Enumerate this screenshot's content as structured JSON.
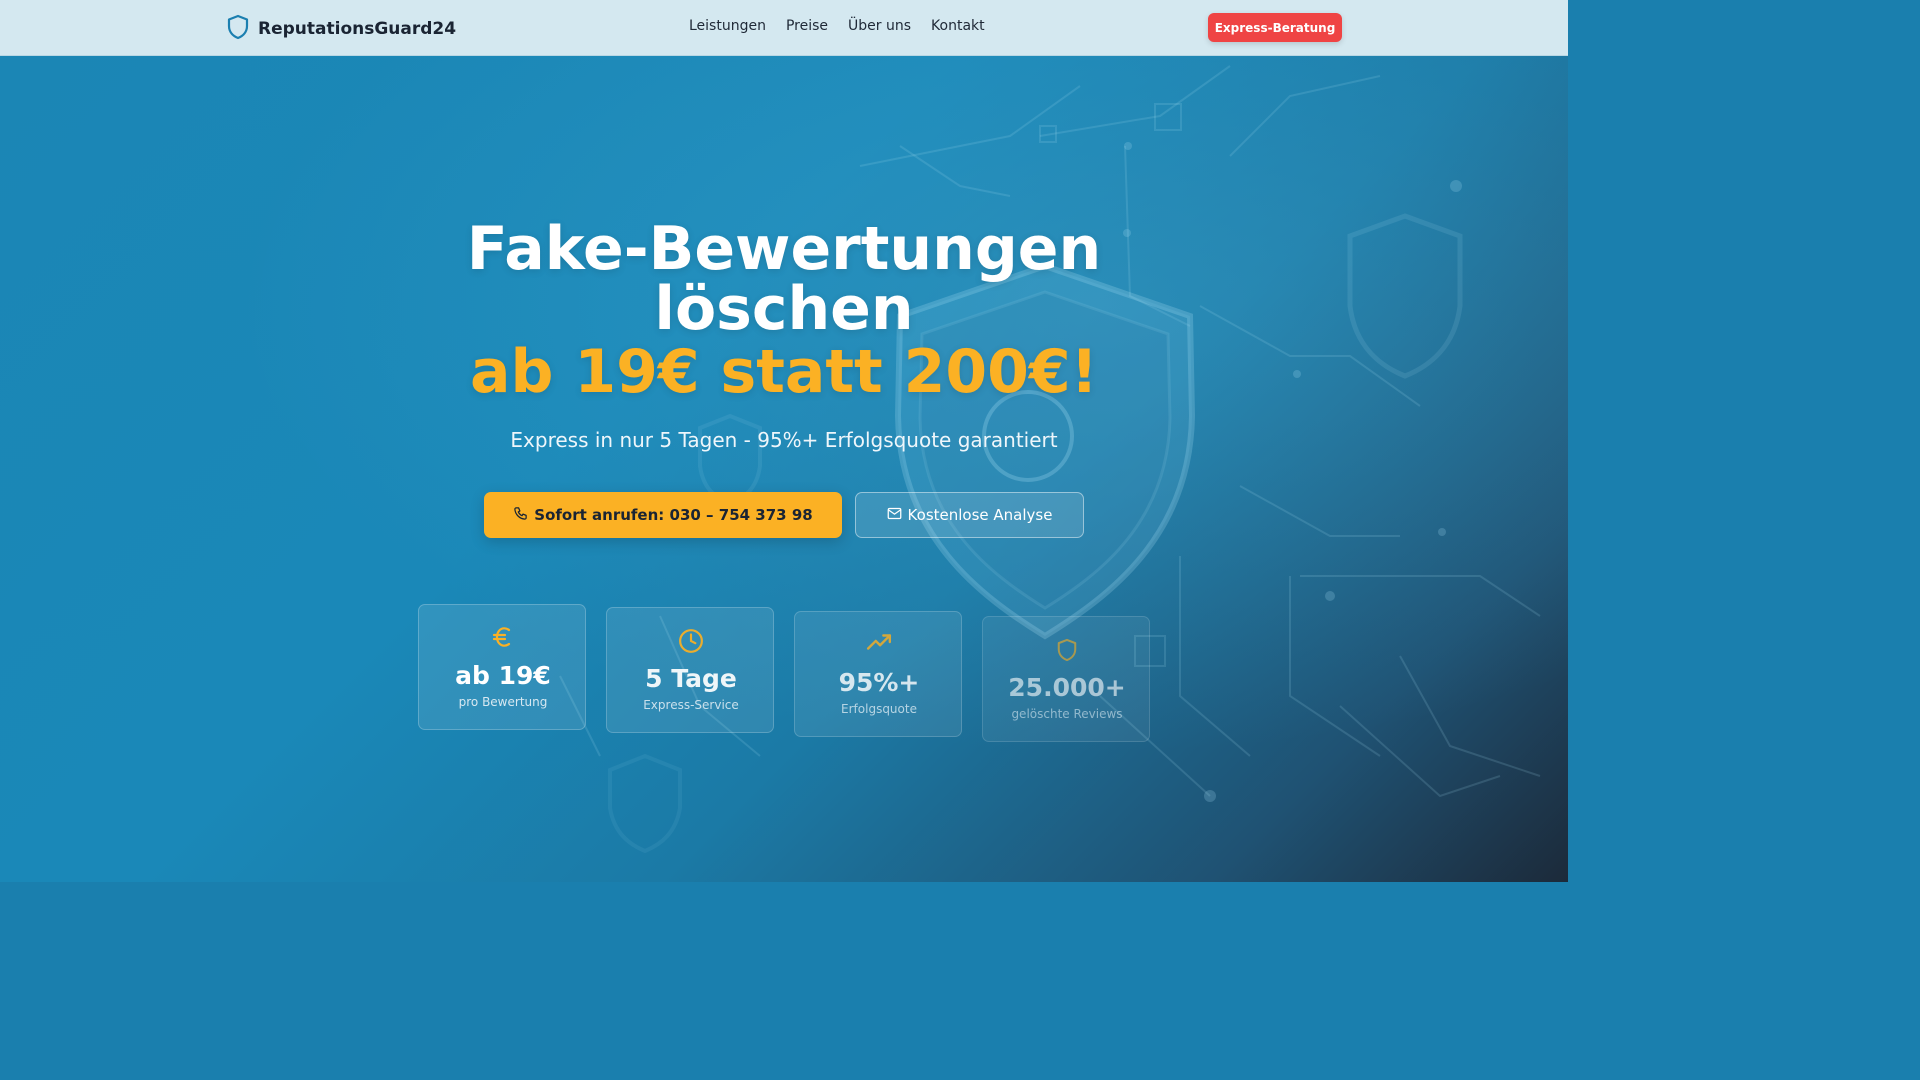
{
  "nav": {
    "brand": "ReputationsGuard24",
    "links": [
      "Leistungen",
      "Preise",
      "Über uns",
      "Kontakt"
    ],
    "cta": "Express-Beratung"
  },
  "hero": {
    "title_line1": "Fake-Bewertungen",
    "title_line2": "löschen",
    "title_line3": "ab 19€ statt 200€!",
    "subtitle": "Express in nur 5 Tagen - 95%+ Erfolgsquote garantiert",
    "primary_button": "Sofort anrufen: 030 – 754 373 98",
    "secondary_button": "Kostenlose Analyse"
  },
  "stats": [
    {
      "icon": "euro-icon",
      "value": "ab 19€",
      "label": "pro Bewertung"
    },
    {
      "icon": "clock-icon",
      "value": "5 Tage",
      "label": "Express-Service"
    },
    {
      "icon": "trending-up-icon",
      "value": "95%+",
      "label": "Erfolgsquote"
    },
    {
      "icon": "shield-icon",
      "value": "25.000+",
      "label": "gelöschte Reviews"
    }
  ],
  "colors": {
    "accent": "#fbb124",
    "cta_red": "#ef4444",
    "brand_blue": "#1a86b5",
    "nav_bg": "#d4e8f0"
  }
}
